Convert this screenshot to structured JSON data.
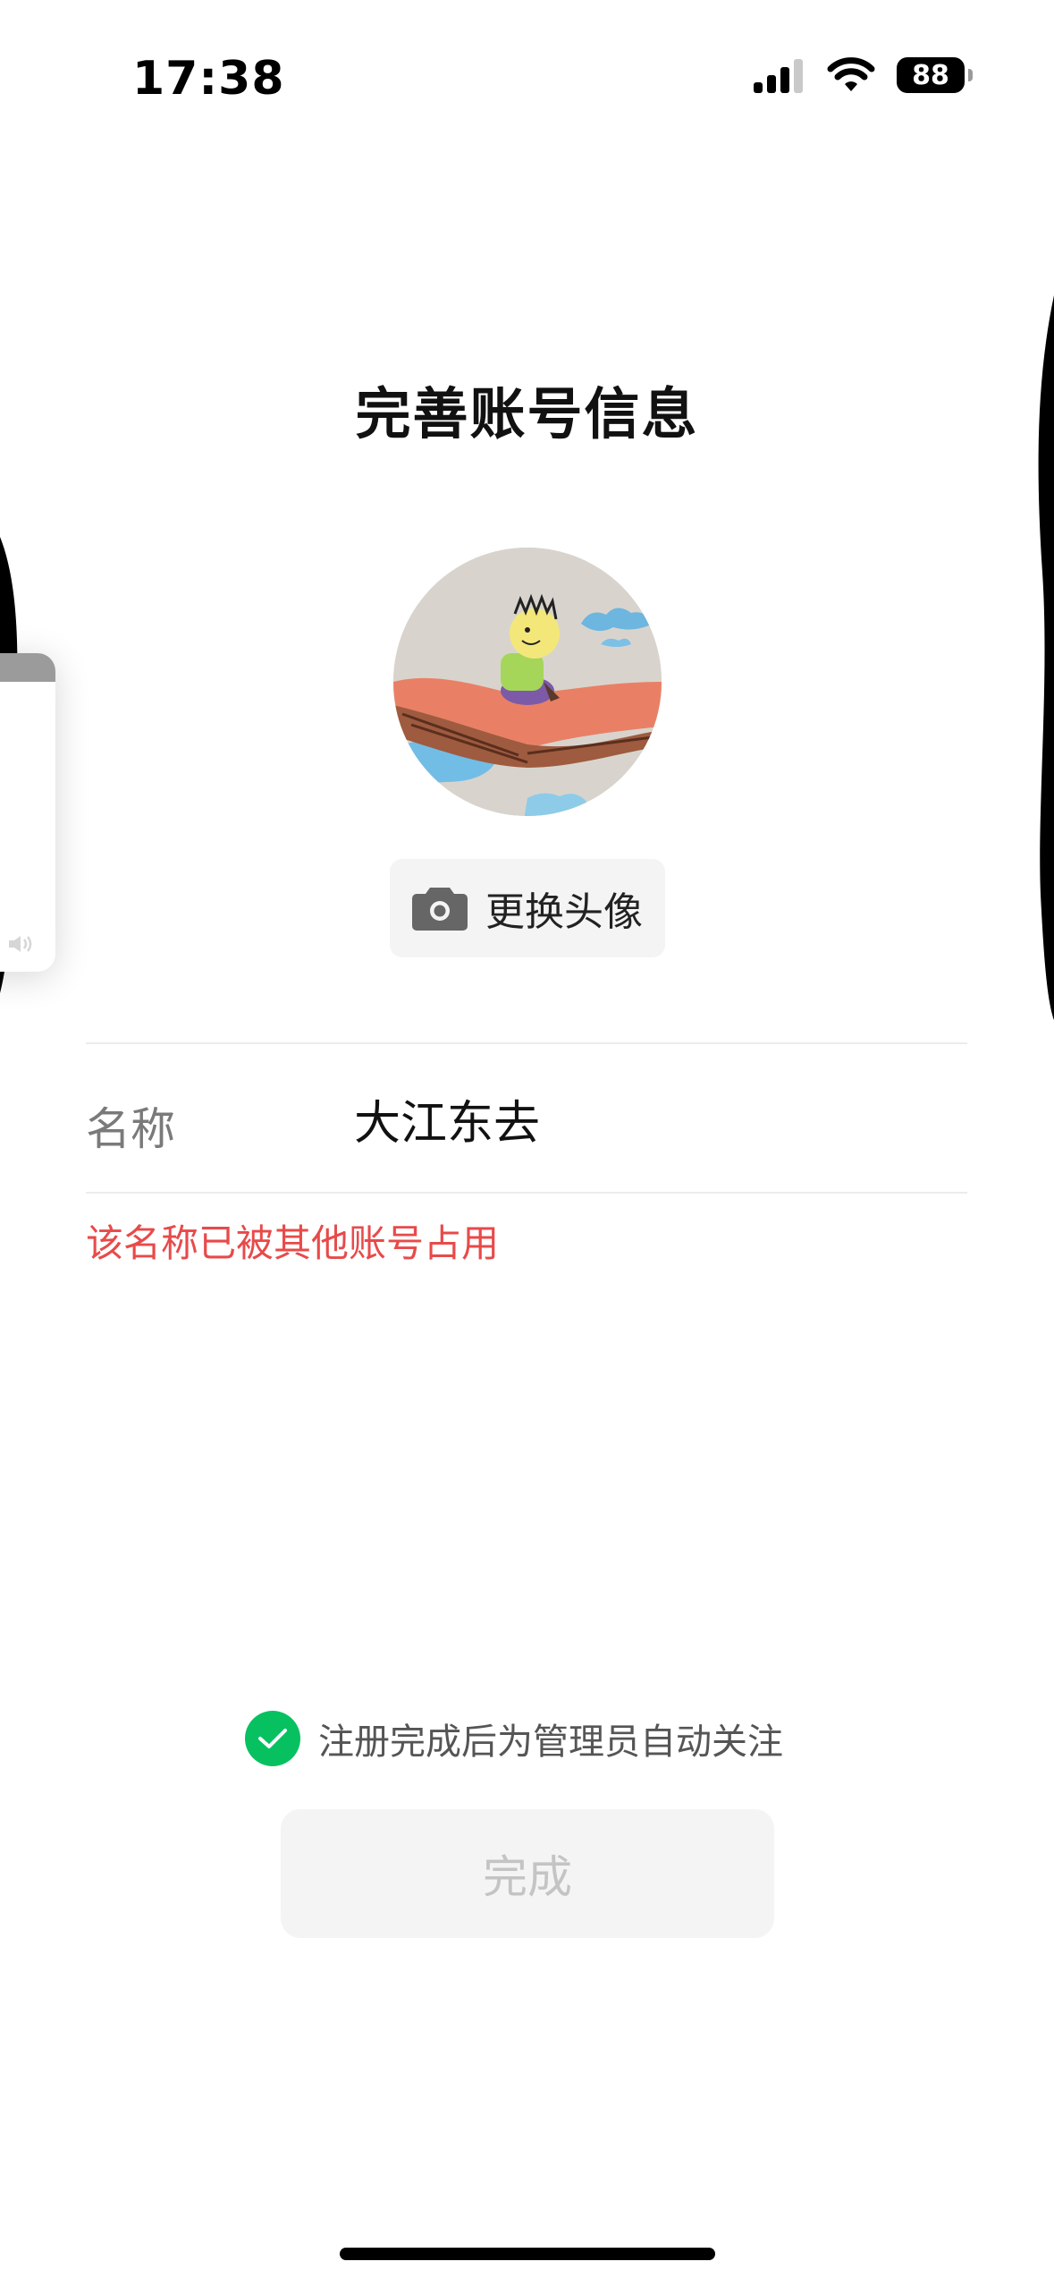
{
  "status_bar": {
    "time": "17:38",
    "battery": "88"
  },
  "page": {
    "title": "完善账号信息"
  },
  "avatar": {
    "change_label": "更换头像"
  },
  "form": {
    "name_label": "名称",
    "name_value": "大江东去",
    "error": "该名称已被其他账号占用"
  },
  "agreement": {
    "checked": true,
    "text": "注册完成后为管理员自动关注"
  },
  "actions": {
    "done_label": "完成"
  },
  "colors": {
    "accent_green": "#07c160",
    "error_red": "#e84a4a",
    "disabled_bg": "#f4f4f4",
    "disabled_text": "#c4c4c4"
  }
}
